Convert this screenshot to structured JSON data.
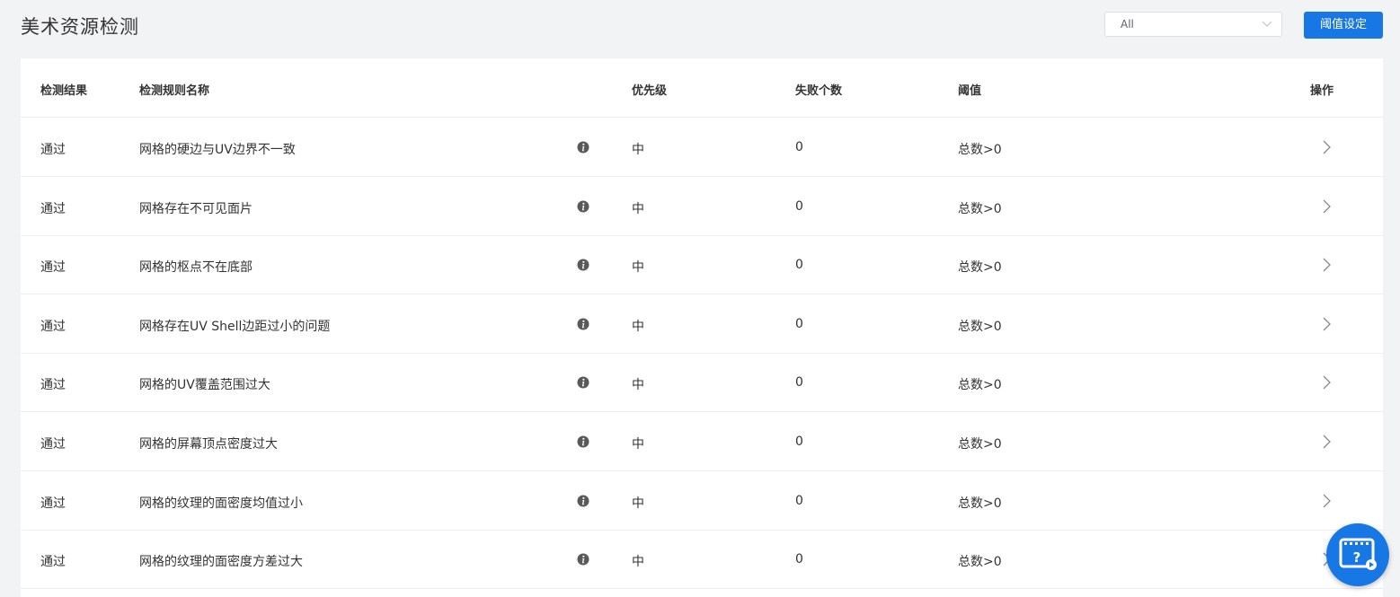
{
  "page": {
    "title": "美术资源检测"
  },
  "filter": {
    "selected": "All"
  },
  "toolbar": {
    "threshold_label": "阈值设定"
  },
  "table": {
    "headers": {
      "result": "检测结果",
      "name": "检测规则名称",
      "priority": "优先级",
      "fail_count": "失败个数",
      "threshold": "阈值",
      "action": "操作"
    },
    "rows": [
      {
        "result": "通过",
        "name": "网格的硬边与UV边界不一致",
        "priority": "中",
        "fail_count": "0",
        "threshold": "总数>0"
      },
      {
        "result": "通过",
        "name": "网格存在不可见面片",
        "priority": "中",
        "fail_count": "0",
        "threshold": "总数>0"
      },
      {
        "result": "通过",
        "name": "网格的枢点不在底部",
        "priority": "中",
        "fail_count": "0",
        "threshold": "总数>0"
      },
      {
        "result": "通过",
        "name": "网格存在UV Shell边距过小的问题",
        "priority": "中",
        "fail_count": "0",
        "threshold": "总数>0"
      },
      {
        "result": "通过",
        "name": "网格的UV覆盖范围过大",
        "priority": "中",
        "fail_count": "0",
        "threshold": "总数>0"
      },
      {
        "result": "通过",
        "name": "网格的屏幕顶点密度过大",
        "priority": "中",
        "fail_count": "0",
        "threshold": "总数>0"
      },
      {
        "result": "通过",
        "name": "网格的纹理的面密度均值过小",
        "priority": "中",
        "fail_count": "0",
        "threshold": "总数>0"
      },
      {
        "result": "通过",
        "name": "网格的纹理的面密度方差过大",
        "priority": "中",
        "fail_count": "0",
        "threshold": "总数>0"
      }
    ]
  },
  "colors": {
    "accent": "#1677e5",
    "priority_mid": "#f5c518",
    "background": "#f2f3f5"
  },
  "icons": {
    "info": "info-icon",
    "action": "chevron-right-icon",
    "help": "help-video-icon"
  }
}
